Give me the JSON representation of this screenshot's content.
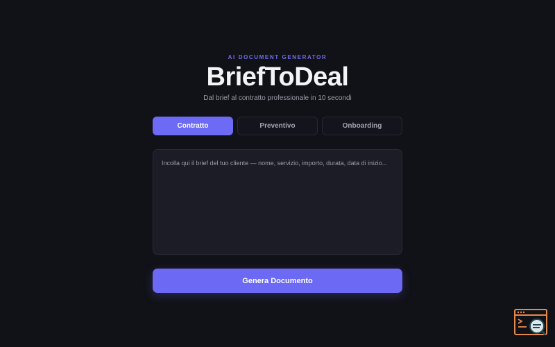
{
  "header": {
    "eyebrow": "AI DOCUMENT GENERATOR",
    "title": "BriefToDeal",
    "subtitle": "Dal brief al contratto professionale in 10 secondi"
  },
  "tabs": [
    {
      "label": "Contratto",
      "active": true
    },
    {
      "label": "Preventivo",
      "active": false
    },
    {
      "label": "Onboarding",
      "active": false
    }
  ],
  "brief": {
    "value": "",
    "placeholder": "Incolla qui il brief del tuo cliente — nome, servizio, importo, durata, data di inizio..."
  },
  "actions": {
    "generate_label": "Genera Documento"
  },
  "widget": {
    "icon": "browser-search-icon"
  },
  "colors": {
    "background": "#111217",
    "accent": "#6c69f4",
    "panel": "#1b1c25",
    "widget": "#e58a4e"
  }
}
